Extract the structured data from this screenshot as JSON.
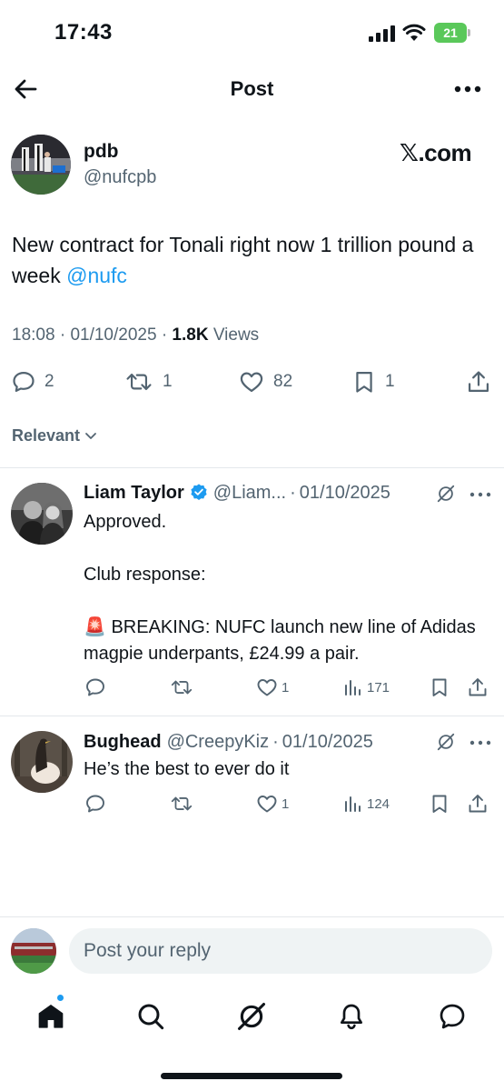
{
  "status_bar": {
    "time": "17:43",
    "battery_level": "21"
  },
  "nav": {
    "title": "Post",
    "back_icon": "arrow-left-icon",
    "more_icon": "more-horizontal-icon"
  },
  "post": {
    "author_name": "pdb",
    "author_handle": "@nufcpb",
    "watermark": "𝕏.com",
    "text": "New contract for Tonali right now 1 trillion pound a week ",
    "mention": "@nufc",
    "time": "18:08",
    "date": "01/10/2025",
    "views_count": "1.8K",
    "views_label": "Views",
    "stats": {
      "replies": "2",
      "reposts": "1",
      "likes": "82",
      "bookmarks": "1"
    }
  },
  "sort": {
    "label": "Relevant"
  },
  "replies": [
    {
      "name": "Liam Taylor",
      "verified": true,
      "handle": "@Liam...",
      "date": "01/10/2025",
      "lines": [
        "Approved.",
        "Club response:",
        "🚨 BREAKING: NUFC launch new line of Adidas magpie underpants, £24.99 a pair."
      ],
      "likes": "1",
      "views": "171"
    },
    {
      "name": "Bughead",
      "verified": false,
      "handle": "@CreepyKiz",
      "date": "01/10/2025",
      "lines": [
        "He’s the best to ever do it"
      ],
      "likes": "1",
      "views": "124"
    }
  ],
  "compose": {
    "placeholder": "Post your reply"
  },
  "tabs": [
    "home-icon",
    "search-icon",
    "grok-icon",
    "notifications-icon",
    "messages-icon"
  ],
  "colors": {
    "accent": "#1d9bf0",
    "secondary_text": "#536471",
    "primary_text": "#0f1419",
    "verified": "#1d9bf0",
    "battery": "#5ac85a"
  }
}
